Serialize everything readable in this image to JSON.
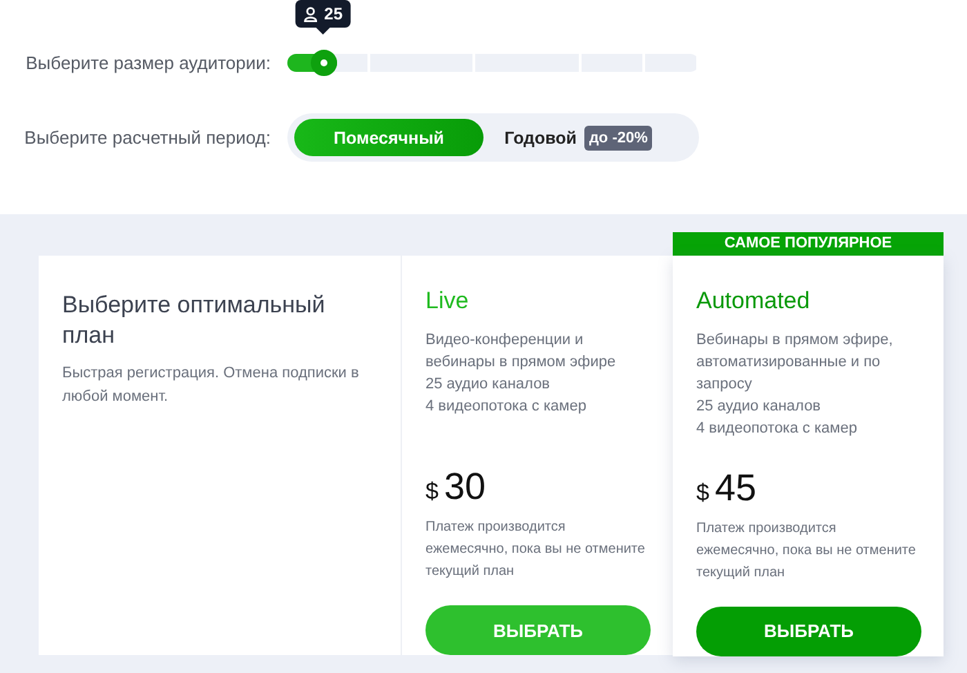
{
  "audience": {
    "label": "Выберите размер аудитории:",
    "value": "25",
    "level": 0.08
  },
  "period": {
    "label": "Выберите расчетный период:",
    "options": [
      {
        "label": "Помесячный",
        "selected": true
      },
      {
        "label": "Годовой",
        "selected": false,
        "badge": "до -20%"
      }
    ]
  },
  "intro": {
    "title": "Выберите оптимальный план",
    "subtitle": "Быстрая регистрация. Отмена подписки в любой момент."
  },
  "plans": [
    {
      "name": "Live",
      "featured": false,
      "features": [
        "Видео-конференции и вебинары в прямом эфире",
        "25 аудио каналов",
        "4 видеопотока с камер"
      ],
      "currency": "$",
      "price": "30",
      "note": "Платеж производится ежемесячно, пока вы не отмените текущий план",
      "button": "ВЫБРАТЬ"
    },
    {
      "name": "Automated",
      "featured": true,
      "banner": "САМОЕ ПОПУЛЯРНОЕ",
      "features": [
        "Вебинары в прямом эфире, автоматизированные и по запросу",
        "25 аудио каналов",
        "4 видеопотока с камер"
      ],
      "currency": "$",
      "price": "45",
      "note": "Платеж производится ежемесячно, пока вы не отмените текущий план",
      "button": "ВЫБРАТЬ"
    }
  ]
}
